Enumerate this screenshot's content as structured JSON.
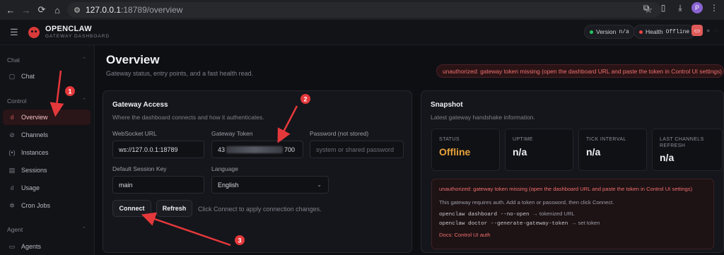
{
  "browser": {
    "url_host": "127.0.0.1",
    "url_path": ":18789/overview",
    "profile_initial": "P"
  },
  "header": {
    "brand_title": "OPENCLAW",
    "brand_subtitle": "GATEWAY DASHBOARD",
    "version_label": "Version",
    "version_value": "n/a",
    "health_label": "Health",
    "health_value": "Offline",
    "status_dot_color": "#22c55e",
    "health_dot_color": "#ef4444"
  },
  "sidebar": {
    "sections": [
      {
        "label": "Chat"
      },
      {
        "label": "Control"
      },
      {
        "label": "Agent"
      }
    ],
    "items": [
      {
        "label": "Chat",
        "icon": "chat-icon"
      },
      {
        "label": "Overview",
        "icon": "bar-chart-icon",
        "active": true
      },
      {
        "label": "Channels",
        "icon": "link-icon"
      },
      {
        "label": "Instances",
        "icon": "radio-icon"
      },
      {
        "label": "Sessions",
        "icon": "file-icon"
      },
      {
        "label": "Usage",
        "icon": "bar-chart-icon"
      },
      {
        "label": "Cron Jobs",
        "icon": "loader-icon"
      },
      {
        "label": "Agents",
        "icon": "folder-icon"
      }
    ]
  },
  "main": {
    "title": "Overview",
    "subtitle": "Gateway status, entry points, and a fast health read.",
    "error_banner": "unauthorized: gateway token missing (open the dashboard URL and paste the token in Control UI settings)"
  },
  "gateway_access": {
    "title": "Gateway Access",
    "subtitle": "Where the dashboard connects and how it authenticates.",
    "websocket_label": "WebSocket URL",
    "websocket_value": "ws://127.0.0.1:18789",
    "token_label": "Gateway Token",
    "token_prefix": "43",
    "token_suffix": "700",
    "password_label": "Password (not stored)",
    "password_placeholder": "system or shared password",
    "session_label": "Default Session Key",
    "session_value": "main",
    "language_label": "Language",
    "language_value": "English",
    "connect_label": "Connect",
    "refresh_label": "Refresh",
    "hint": "Click Connect to apply connection changes."
  },
  "snapshot": {
    "title": "Snapshot",
    "subtitle": "Latest gateway handshake information.",
    "stats": [
      {
        "label": "STATUS",
        "value": "Offline"
      },
      {
        "label": "UPTIME",
        "value": "n/a"
      },
      {
        "label": "TICK INTERVAL",
        "value": "n/a"
      },
      {
        "label": "LAST CHANNELS REFRESH",
        "value": "n/a"
      }
    ],
    "error_title": "unauthorized: gateway token missing (open the dashboard URL and paste the token in Control UI settings)",
    "error_detail": "This gateway requires auth. Add a token or password, then click Connect.",
    "cmd1": "openclaw dashboard --no-open",
    "cmd1_rest": "→ tokenized URL",
    "cmd2": "openclaw doctor --generate-gateway-token",
    "cmd2_rest": "→ set token",
    "docs_link": "Docs: Control UI auth"
  },
  "annotations": {
    "color": "#e5383b",
    "labels": [
      "1",
      "2",
      "3"
    ]
  }
}
